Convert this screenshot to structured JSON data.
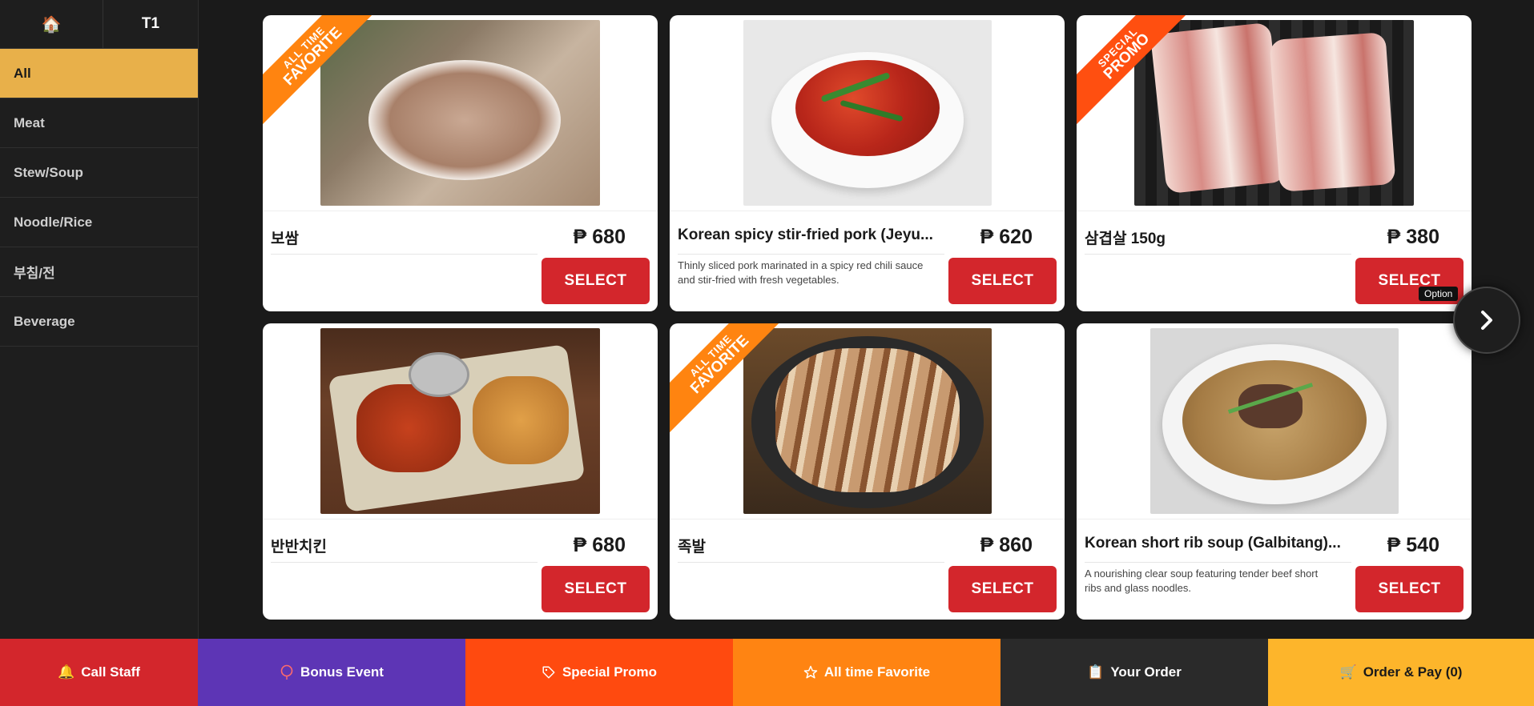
{
  "sidebar": {
    "home_icon": "🏠",
    "table": "T1",
    "items": [
      {
        "label": "All"
      },
      {
        "label": "Meat"
      },
      {
        "label": "Stew/Soup"
      },
      {
        "label": "Noodle/Rice"
      },
      {
        "label": "부침/전"
      },
      {
        "label": "Beverage"
      }
    ]
  },
  "ribbons": {
    "fav_line1": "ALL TIME",
    "fav_line2": "FAVORITE",
    "promo_line1": "SPECIAL",
    "promo_line2": "PROMO"
  },
  "items": [
    {
      "name": "보쌈",
      "price": "₱ 680",
      "desc": "",
      "select": "SELECT"
    },
    {
      "name": "Korean spicy stir-fried pork (Jeyu...",
      "price": "₱ 620",
      "desc": "Thinly sliced pork marinated in a spicy red chili sauce and stir-fried with fresh vegetables.",
      "select": "SELECT"
    },
    {
      "name": "삼겹살 150g",
      "price": "₱ 380",
      "desc": "",
      "select": "SELECT"
    },
    {
      "name": "반반치킨",
      "price": "₱ 680",
      "desc": "",
      "select": "SELECT"
    },
    {
      "name": "족발",
      "price": "₱ 860",
      "desc": "",
      "select": "SELECT"
    },
    {
      "name": "Korean short rib soup (Galbitang)...",
      "price": "₱ 540",
      "desc": "A nourishing clear soup featuring tender beef short ribs and glass noodles.",
      "select": "SELECT"
    }
  ],
  "tooltip": "Option",
  "bottom_bar": {
    "call_staff": "Call Staff",
    "bonus_event": "Bonus Event",
    "special_promo": "Special Promo",
    "all_time_favorite": "All time Favorite",
    "your_order": "Your Order",
    "order_pay": "Order & Pay (0)"
  },
  "colors": {
    "accent_active": "#e8b04a",
    "select_red": "#d3262c",
    "bonus_purple": "#5d35b5",
    "promo_orange": "#ff4a0f",
    "fav_orange": "#ff8412",
    "pay_yellow": "#fdb52b"
  }
}
